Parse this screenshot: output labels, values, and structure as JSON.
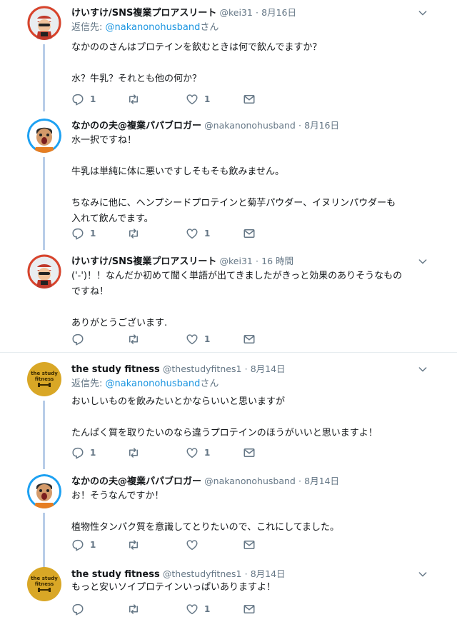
{
  "colors": {
    "mention": "#1b95e0",
    "meta": "#657786",
    "thread_line": "#b8cde8",
    "logo_gold": "#d9a726"
  },
  "tweets": [
    {
      "name": "けいすけ/SNS複業プロアスリート",
      "handle": "@kei31",
      "sep": "·",
      "time": "8月16日",
      "reply_prefix": "返信先: ",
      "reply_mention": "@nakanonohusband",
      "reply_suffix": "さん",
      "lines": [
        "なかののさんはプロテインを飲むときは何で飲んでますか？",
        "",
        "水？牛乳？それとも他の何か？"
      ],
      "reply_count": "1",
      "retweet_count": "",
      "like_count": "1"
    },
    {
      "name": "なかのの夫@複業パパブロガー",
      "handle": "@nakanonohusband",
      "sep": "·",
      "time": "8月16日",
      "lines": [
        "水一択ですね！",
        "",
        "牛乳は単純に体に悪いですしそもそも飲みません。",
        "",
        "ちなみに他に、ヘンプシードプロテインと菊芋パウダー、イヌリンパウダーも",
        "入れて飲んでます。"
      ],
      "reply_count": "1",
      "retweet_count": "",
      "like_count": "1"
    },
    {
      "name": "けいすけ/SNS複業プロアスリート",
      "handle": "@kei31",
      "sep": "·",
      "time": "16 時間",
      "lines": [
        "('-')！！なんだか初めて聞く単語が出てきましたがきっと効果のありそうなもの",
        "ですね！",
        "",
        "ありがとうございます."
      ],
      "reply_count": "",
      "retweet_count": "",
      "like_count": "1"
    },
    {
      "name": "the study fitness",
      "handle": "@thestudyfitnes1",
      "sep": "·",
      "time": "8月14日",
      "reply_prefix": "返信先: ",
      "reply_mention": "@nakanonohusband",
      "reply_suffix": "さん",
      "lines": [
        "おいしいものを飲みたいとかならいいと思いますが",
        "",
        "たんぱく質を取りたいのなら違うプロテインのほうがいいと思いますよ！"
      ],
      "reply_count": "1",
      "retweet_count": "",
      "like_count": "1"
    },
    {
      "name": "なかのの夫@複業パパブロガー",
      "handle": "@nakanonohusband",
      "sep": "·",
      "time": "8月14日",
      "lines": [
        "お！そうなんですか！",
        "",
        "植物性タンパク質を意識してとりたいので、これにしてました。"
      ],
      "reply_count": "1",
      "retweet_count": "",
      "like_count": ""
    },
    {
      "name": "the study fitness",
      "handle": "@thestudyfitnes1",
      "sep": "·",
      "time": "8月14日",
      "lines": [
        "もっと安いソイプロテインいっぱいありますよ！"
      ],
      "reply_count": "",
      "retweet_count": "",
      "like_count": "1"
    }
  ],
  "logo": {
    "line1": "the study",
    "line2": "fitness"
  }
}
